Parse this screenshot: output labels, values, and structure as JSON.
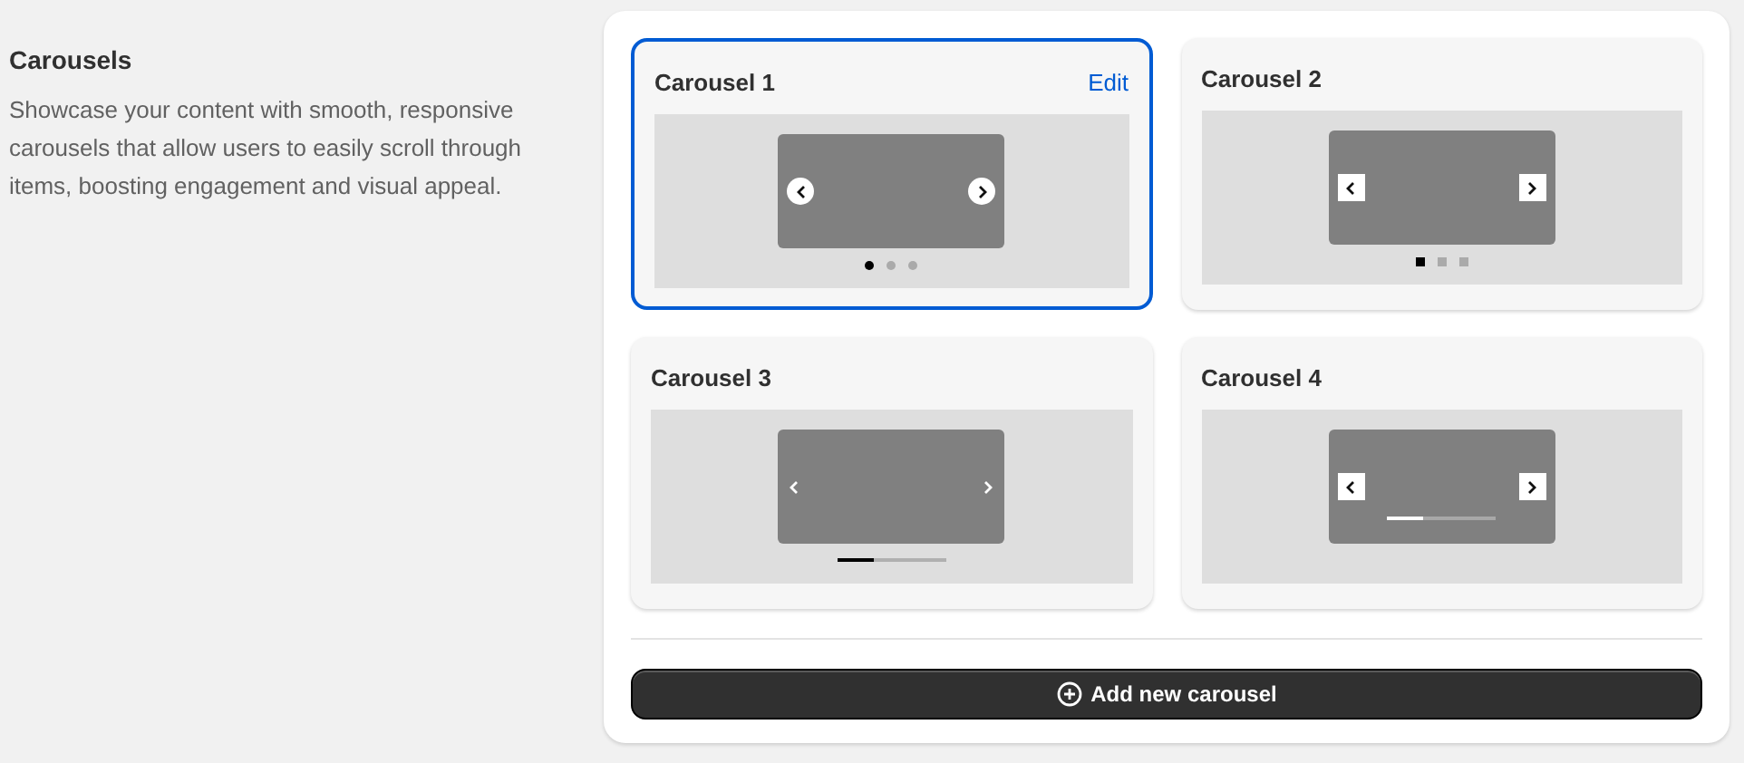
{
  "section": {
    "title": "Carousels",
    "description": "Showcase your content with smooth, responsive carousels that allow users to easily scroll through items, boosting engagement and visual appeal."
  },
  "carousels": [
    {
      "title": "Carousel 1",
      "selected": true,
      "edit_label": "Edit",
      "kind": "round-dots",
      "dots": [
        {
          "selected": true
        },
        {
          "selected": false
        },
        {
          "selected": false
        }
      ]
    },
    {
      "title": "Carousel 2",
      "selected": false,
      "kind": "square-dots",
      "dots": [
        {
          "selected": true
        },
        {
          "selected": false
        },
        {
          "selected": false
        }
      ]
    },
    {
      "title": "Carousel 3",
      "selected": false,
      "kind": "bar",
      "level": 0.33
    },
    {
      "title": "Carousel 4",
      "selected": false,
      "kind": "inner-bar",
      "level": 0.33
    }
  ],
  "add_button": {
    "label": "Add new carousel"
  }
}
